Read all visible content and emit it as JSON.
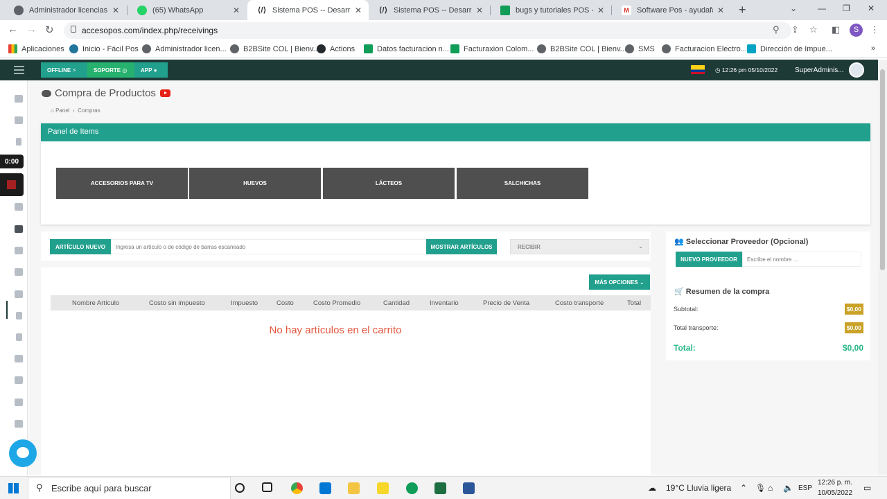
{
  "browser": {
    "tabs": [
      {
        "title": "Administrador licencias POS",
        "icon": "globe-icon"
      },
      {
        "title": "(65) WhatsApp",
        "icon": "whatsapp-icon"
      },
      {
        "title": "Sistema POS -- Desarrollado",
        "icon": "code-icon",
        "active": true
      },
      {
        "title": "Sistema POS -- Desarrollado",
        "icon": "code-icon"
      },
      {
        "title": "bugs y tutoriales POS - Hoja",
        "icon": "sheets-icon"
      },
      {
        "title": "Software Pos - ayudafacilpos",
        "icon": "gmail-icon"
      }
    ],
    "url": "accesopos.com/index.php/receivings",
    "profile_initial": "S",
    "bookmarks": [
      "Aplicaciones",
      "Inicio - Fácil Pos",
      "Administrador licen...",
      "B2BSite COL | Bienv...",
      "Actions",
      "Datos facturacion n...",
      "Facturaxion Colom...",
      "B2BSite COL | Bienv...",
      "SMS",
      "Facturacion Electro...",
      "Dirección de Impue..."
    ]
  },
  "header": {
    "offline": "OFFLINE",
    "soporte": "SOPORTE",
    "app": "APP",
    "datetime": "12:26 pm 05/10/2022",
    "user": "SuperAdminis..."
  },
  "recorder": {
    "time": "0:00"
  },
  "page": {
    "title": "Compra de Productos",
    "breadcrumb_home": "Panel",
    "breadcrumb_current": "Compras"
  },
  "items_panel": {
    "title": "Panel de Items",
    "categories": [
      "ACCESORIOS PARA TV",
      "HUEVOS",
      "LÁCTEOS",
      "SALCHICHAS"
    ]
  },
  "search": {
    "new_item": "ARTÍCULO NUEVO",
    "placeholder": "Ingresa un artículo o de código de barras escaneado",
    "show_items": "MOSTRAR ARTÍCULOS",
    "mode": "RECIBIR"
  },
  "cart": {
    "more_options": "MÁS OPCIONES",
    "columns": [
      "Nombre Artículo",
      "Costo sin impuesto",
      "Impuesto",
      "Costo",
      "Costo Promedio",
      "Cantidad",
      "Inventario",
      "Precio de Venta",
      "Costo transporte",
      "Total"
    ],
    "empty_message": "No hay artículos en el carrito"
  },
  "supplier": {
    "title": "Seleccionar Proveedor (Opcional)",
    "new_button": "NUEVO PROVEEDOR",
    "placeholder": "Escribe el nombre ..."
  },
  "summary": {
    "title": "Resumen de la compra",
    "subtotal_label": "Subtotal:",
    "subtotal": "$0,00",
    "transport_label": "Total transporte:",
    "transport": "$0,00",
    "total_label": "Total:",
    "total": "$0,00"
  },
  "taskbar": {
    "search": "Escribe aquí para buscar",
    "weather": "19°C  Lluvia ligera",
    "lang": "ESP",
    "time": "12:26 p. m.",
    "date": "10/05/2022"
  },
  "colors": {
    "accent": "#22a08e",
    "header": "#1e3a37",
    "empty": "#e4573d",
    "money": "#c9a227"
  }
}
